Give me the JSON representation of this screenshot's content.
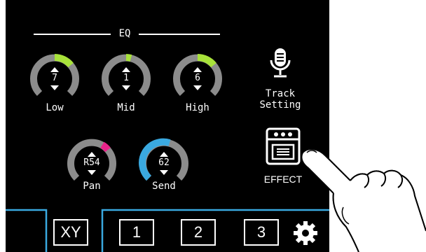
{
  "eq": {
    "title": "EQ",
    "knobs": [
      {
        "label": "Low",
        "value": "7",
        "level": 0.2,
        "color": "#a8e23a"
      },
      {
        "label": "Mid",
        "value": "1",
        "level": 0.03,
        "color": "#a8e23a"
      },
      {
        "label": "High",
        "value": "6",
        "level": 0.2,
        "color": "#a8e23a"
      }
    ]
  },
  "mix": {
    "knobs": [
      {
        "label": "Pan",
        "value": "R54",
        "level": 0.1,
        "color": "#e8248a"
      },
      {
        "label": "Send",
        "value": "62",
        "level": 0.55,
        "color": "#3aa9e0"
      }
    ]
  },
  "track_setting": {
    "line1": "Track",
    "line2": "Setting",
    "icon": "microphone-icon"
  },
  "effect": {
    "label": "EFFECT",
    "icon": "effect-pedal-icon"
  },
  "tabs": [
    "XY",
    "1",
    "2",
    "3"
  ],
  "settings_icon": "gear-icon",
  "colors": {
    "background": "#000000",
    "knob_track": "#8c8c8c",
    "accent_line": "#3aa9e0"
  }
}
